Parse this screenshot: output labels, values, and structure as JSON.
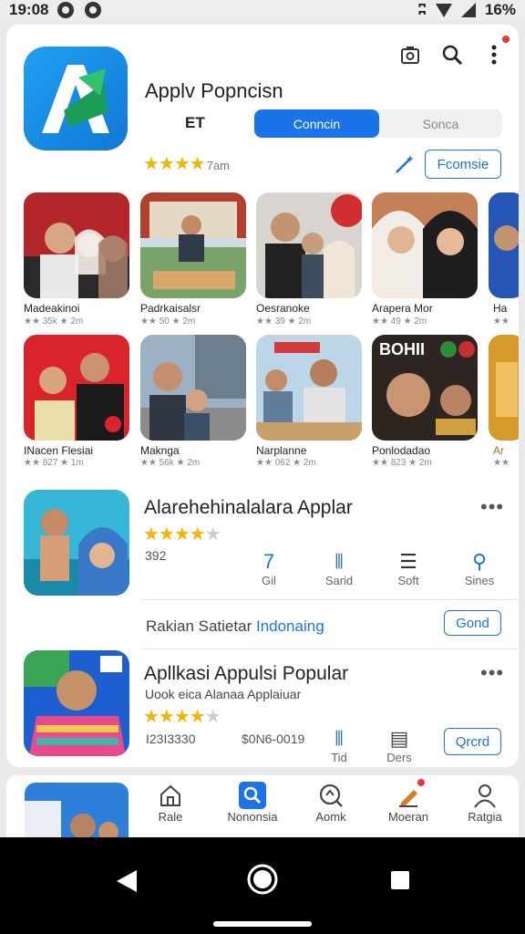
{
  "status": {
    "time": "19:08",
    "battery": "16%"
  },
  "app": {
    "title": "Applv Popncisn",
    "et_label": "ET",
    "segment_active": "Conncin",
    "segment_inactive": "Sonca",
    "rating_text": "7am",
    "action_button": "Fcomsie"
  },
  "grid": {
    "row1": [
      {
        "name": "Madeakinoi",
        "meta": "★★ 35k ★ 2m"
      },
      {
        "name": "Padrkaisalsr",
        "meta": "★★ 50 ★ 2m"
      },
      {
        "name": "Oesranoke",
        "meta": "★★ 39 ★ 2m"
      },
      {
        "name": "Arapera Mor",
        "meta": "★★ 49 ★ 2m"
      },
      {
        "name": "Ha",
        "meta": "★★"
      }
    ],
    "row2": [
      {
        "name": "INacen Flesiai",
        "meta": "★★ 827 ★ 1m"
      },
      {
        "name": "Maknga",
        "meta": "★★ 56k ★ 2m"
      },
      {
        "name": "Narplanne",
        "meta": "★★ 062 ★ 2m"
      },
      {
        "name": "Ponlodadao",
        "meta": "★★ 823 ★ 2m"
      },
      {
        "name": "Ar",
        "meta": "★★"
      }
    ]
  },
  "featured": {
    "title": "Alarehehinalalara Applar",
    "count": "392",
    "stats": [
      {
        "icon": "7",
        "label": "Gil"
      },
      {
        "icon": "⫴",
        "label": "Sarid"
      },
      {
        "icon": "☰",
        "label": "Soft"
      },
      {
        "icon": "⚲",
        "label": "Sines"
      }
    ],
    "promo_text": "Rakian Satietar",
    "promo_link": "Indonaing",
    "button": "Gond"
  },
  "popular": {
    "title": "Apllkasi Appulsi Popular",
    "subtitle": "Uook eica Alanaa Applaiuar",
    "num1": "I23I3330",
    "num2": "$0N6-0019",
    "stat1": "Tid",
    "stat2": "Ders",
    "button": "Qrcrd"
  },
  "nav": [
    "Rale",
    "Nononsia",
    "Aomk",
    "Moeran",
    "Ratgia"
  ]
}
